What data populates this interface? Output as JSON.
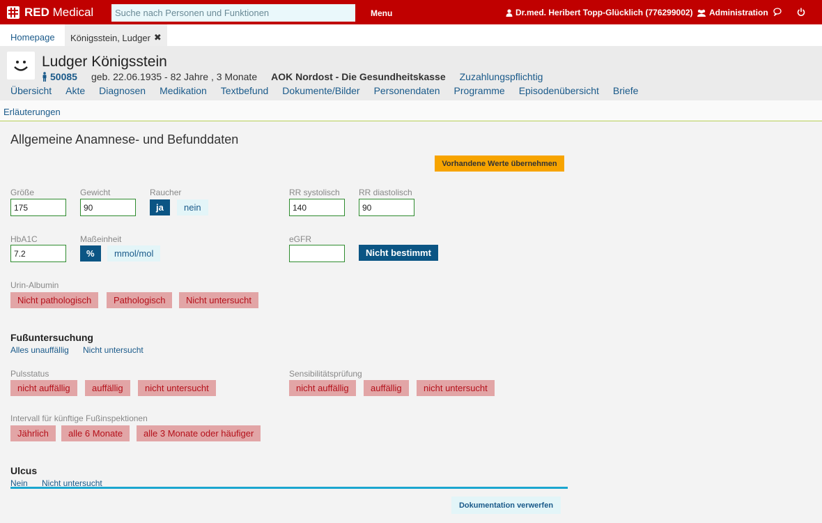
{
  "topbar": {
    "logo_text": "RED Medical",
    "search_placeholder": "Suche nach Personen und Funktionen",
    "menu_label": "Menu",
    "user_label": "Dr.med. Heribert Topp-Glücklich (776299002)",
    "admin_label": "Administration",
    "colors": {
      "bar": "#c00000"
    }
  },
  "tabs": [
    {
      "label": "Homepage"
    },
    {
      "label": "Königsstein, Ludger"
    }
  ],
  "patient": {
    "name": "Ludger Königsstein",
    "id": "50085",
    "birth": "geb. 22.06.1935 - 82 Jahre , 3 Monate",
    "insurance": "AOK Nordost - Die Gesundheitskasse",
    "copay": "Zuzahlungspflichtig"
  },
  "nav": [
    "Übersicht",
    "Akte",
    "Diagnosen",
    "Medikation",
    "Textbefund",
    "Dokumente/Bilder",
    "Personendaten",
    "Programme",
    "Episodenübersicht",
    "Briefe"
  ],
  "subbar": {
    "link": "Erläuterungen"
  },
  "content": {
    "title": "Allgemeine Anamnese- und Befunddaten",
    "apply_button": "Vorhandene Werte übernehmen",
    "groesse": {
      "label": "Größe",
      "value": "175"
    },
    "gewicht": {
      "label": "Gewicht",
      "value": "90"
    },
    "raucher": {
      "label": "Raucher",
      "ja": "ja",
      "nein": "nein"
    },
    "rr_sys": {
      "label": "RR systolisch",
      "value": "140"
    },
    "rr_dia": {
      "label": "RR diastolisch",
      "value": "90"
    },
    "hba1c": {
      "label": "HbA1C",
      "value": "7.2"
    },
    "masseinheit": {
      "label": "Maßeinheit",
      "percent": "%",
      "mmol": "mmol/mol"
    },
    "egfr": {
      "label": "eGFR",
      "value": "",
      "not_determined": "Nicht bestimmt"
    },
    "urin": {
      "label": "Urin-Albumin",
      "options": [
        "Nicht pathologisch",
        "Pathologisch",
        "Nicht untersucht"
      ]
    },
    "fuss": {
      "title": "Fußuntersuchung",
      "all_ok": "Alles unauffällig",
      "not_examined": "Nicht untersucht"
    },
    "puls": {
      "label": "Pulsstatus",
      "options": [
        "nicht auffällig",
        "auffällig",
        "nicht untersucht"
      ]
    },
    "sens": {
      "label": "Sensibilitätsprüfung",
      "options": [
        "nicht auffällig",
        "auffällig",
        "nicht untersucht"
      ]
    },
    "intervall": {
      "label": "Intervall für künftige Fußinspektionen",
      "options": [
        "Jährlich",
        "alle 6 Monate",
        "alle 3 Monate oder häufiger"
      ]
    },
    "ulcus": {
      "title": "Ulcus",
      "nein": "Nein",
      "not_examined": "Nicht untersucht"
    },
    "discard_button": "Dokumentation verwerfen"
  }
}
